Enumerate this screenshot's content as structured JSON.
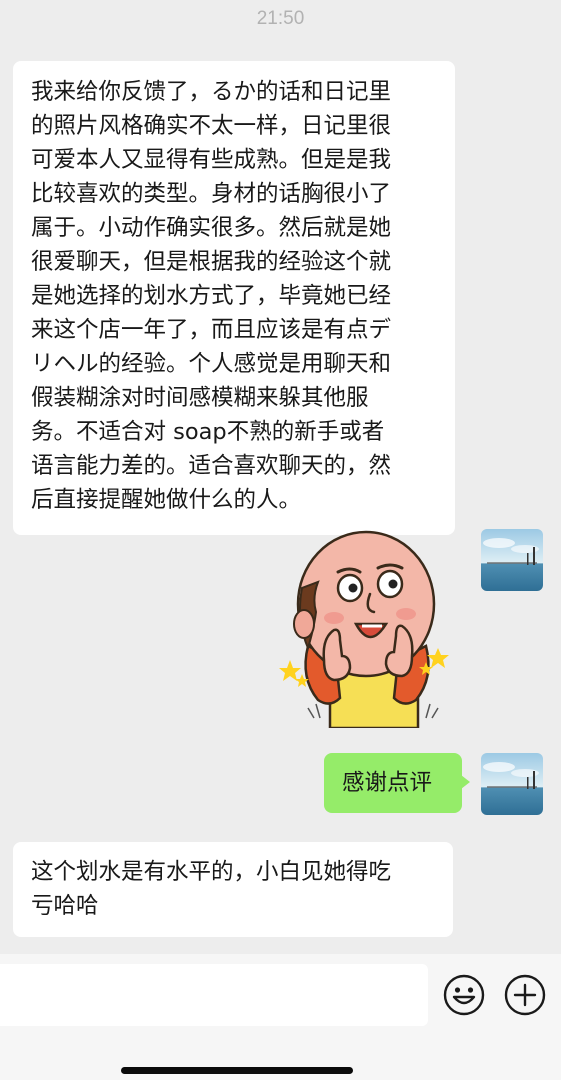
{
  "status": {
    "time": "21:50"
  },
  "messages": [
    {
      "sender": "other",
      "lines": [
        "我来给你反馈了，るか的话和日记里",
        "的照片风格确实不太一样，日记里很",
        "可爱本人又显得有些成熟。但是是我",
        "比较喜欢的类型。身材的话胸很小了",
        "属于。小动作确实很多。然后就是她",
        "很爱聊天，但是根据我的经验这个就",
        "是她选择的划水方式了，毕竟她已经",
        "来这个店一年了，而且应该是有点デ",
        "リヘル的经验。个人感觉是用聊天和",
        "假装糊涂对时间感模糊来躲其他服",
        "务。不适合对 soap不熟的新手或者",
        "语言能力差的。适合喜欢聊天的，然",
        "后直接提醒她做什么的人。"
      ]
    },
    {
      "sender": "me",
      "type": "sticker",
      "sticker_name": "thumbs-up-bald-man-sticker"
    },
    {
      "sender": "me",
      "text": "感谢点评"
    },
    {
      "sender": "other",
      "lines": [
        "这个划水是有水平的，小白见她得吃",
        "亏哈哈"
      ]
    }
  ],
  "input_bar": {
    "emoji_icon": "smiley-face-icon",
    "plus_icon": "plus-circle-icon"
  },
  "colors": {
    "background": "#ededed",
    "incoming_bubble": "#ffffff",
    "outgoing_bubble": "#95ec69",
    "text": "#191919",
    "timestamp": "#b2b2b2"
  }
}
